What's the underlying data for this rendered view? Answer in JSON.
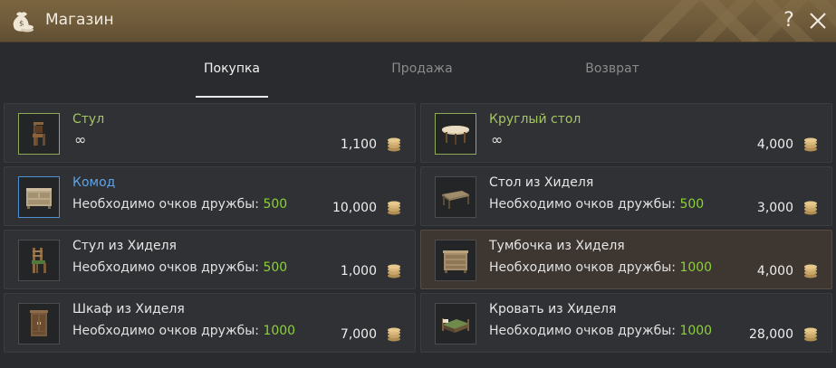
{
  "window": {
    "title": "Магазин"
  },
  "tabs": [
    {
      "label": "Покупка",
      "active": true
    },
    {
      "label": "Продажа",
      "active": false
    },
    {
      "label": "Возврат",
      "active": false
    }
  ],
  "items": [
    {
      "name": "Стул",
      "name_color": "green",
      "infinite": true,
      "infinity_symbol": "∞",
      "price": "1,100"
    },
    {
      "name": "Круглый стол",
      "name_color": "green",
      "infinite": true,
      "infinity_symbol": "∞",
      "price": "4,000"
    },
    {
      "name": "Комод",
      "name_color": "blue",
      "req_label": "Необходимо очков дружбы:",
      "req_value": "500",
      "price": "10,000"
    },
    {
      "name": "Стол из Хиделя",
      "name_color": "white",
      "req_label": "Необходимо очков дружбы:",
      "req_value": "500",
      "price": "3,000"
    },
    {
      "name": "Стул из Хиделя",
      "name_color": "white",
      "req_label": "Необходимо очков дружбы:",
      "req_value": "500",
      "price": "1,000"
    },
    {
      "name": "Тумбочка из Хиделя",
      "name_color": "white",
      "req_label": "Необходимо очков дружбы:",
      "req_value": "1000",
      "price": "4,000",
      "highlighted": true
    },
    {
      "name": "Шкаф из Хиделя",
      "name_color": "white",
      "req_label": "Необходимо очков дружбы:",
      "req_value": "1000",
      "price": "7,000"
    },
    {
      "name": "Кровать из Хиделя",
      "name_color": "white",
      "req_label": "Необходимо очков дружбы:",
      "req_value": "1000",
      "price": "28,000"
    }
  ],
  "icons": {
    "title": "money-bag-icon",
    "help": "help-icon",
    "help_glyph": "?",
    "close": "close-icon",
    "currency": "silver-coin-icon"
  },
  "colors": {
    "titlebar": "#6e5a3a",
    "name_green": "#a4c562",
    "name_blue": "#5ea3e6",
    "req_value": "#8bd13a",
    "highlight_bg": "#3d3631"
  }
}
